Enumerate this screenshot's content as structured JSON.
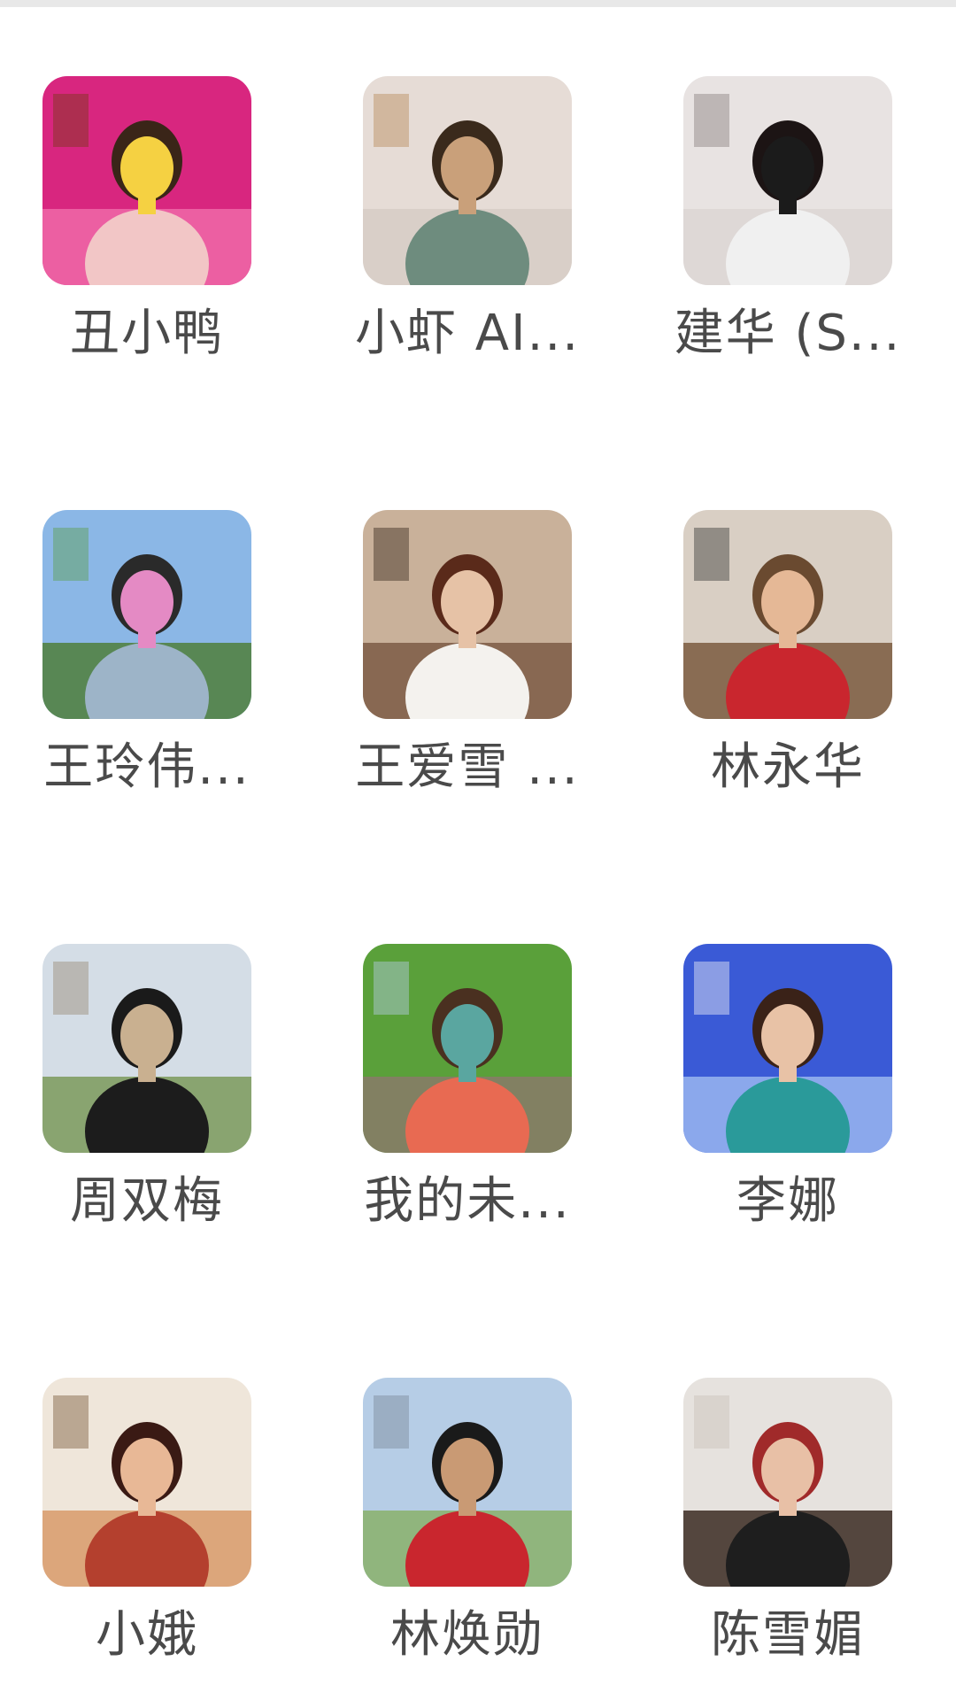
{
  "members": [
    {
      "name": "丑小鸭",
      "avatar": {
        "bg": "#d8267f",
        "bg2": "#f06aa8",
        "person": "#f2c6c6",
        "hair": "#3a2518",
        "accent": "#f5d142",
        "extra": "#7a3a18"
      }
    },
    {
      "name": "小虾 AI...",
      "avatar": {
        "bg": "#e6dcd6",
        "bg2": "#d6ccc6",
        "person": "#6e8c7e",
        "hair": "#3a2a1c",
        "accent": "#c9a07a",
        "extra": "#b78a5a"
      }
    },
    {
      "name": "建华 (S...",
      "avatar": {
        "bg": "#e8e3e2",
        "bg2": "#dcd6d4",
        "person": "#f0f0f0",
        "hair": "#1c1414",
        "accent": "#1b1b1b",
        "extra": "#8a7e7e"
      }
    },
    {
      "name": "王玲伟...",
      "avatar": {
        "bg": "#8bb7e6",
        "bg2": "#4f7f3a",
        "person": "#9db4c8",
        "hair": "#2a2a2a",
        "accent": "#e48ac4",
        "extra": "#5ea050"
      }
    },
    {
      "name": "王爱雪 ...",
      "avatar": {
        "bg": "#c9b19a",
        "bg2": "#7c5c45",
        "person": "#f4f2ee",
        "hair": "#5a2a1a",
        "accent": "#e6c2a6",
        "extra": "#3a2a20"
      }
    },
    {
      "name": "林永华",
      "avatar": {
        "bg": "#d9cfc4",
        "bg2": "#7a5a40",
        "person": "#c9262e",
        "hair": "#6a4a30",
        "accent": "#e5b896",
        "extra": "#3a3a3a"
      }
    },
    {
      "name": "周双梅",
      "avatar": {
        "bg": "#d4dde6",
        "bg2": "#7b9a5a",
        "person": "#1c1c1c",
        "hair": "#1a1a1a",
        "accent": "#c9b090",
        "extra": "#9a8a76"
      }
    },
    {
      "name": "我的未...",
      "avatar": {
        "bg": "#5aa03a",
        "bg2": "#8a7a6a",
        "person": "#e86a52",
        "hair": "#4a3020",
        "accent": "#5aa6a0",
        "extra": "#b6cde6"
      }
    },
    {
      "name": "李娜",
      "avatar": {
        "bg": "#3a5ad6",
        "bg2": "#9ab6f0",
        "person": "#2a9a9a",
        "hair": "#3a2218",
        "accent": "#e8c2a6",
        "extra": "#f0f0f6"
      }
    },
    {
      "name": "小娥",
      "avatar": {
        "bg": "#efe6da",
        "bg2": "#d89a6a",
        "person": "#b4402e",
        "hair": "#3a1a14",
        "accent": "#e8b896",
        "extra": "#7a5a3a"
      }
    },
    {
      "name": "林焕勋",
      "avatar": {
        "bg": "#b6cde6",
        "bg2": "#8ab06a",
        "person": "#c9262e",
        "hair": "#1a1a1a",
        "accent": "#c99a74",
        "extra": "#7a8a9a"
      }
    },
    {
      "name": "陈雪媚",
      "avatar": {
        "bg": "#e6e2de",
        "bg2": "#3a2a22",
        "person": "#1e1e1e",
        "hair": "#a02a2a",
        "accent": "#e8c0a6",
        "extra": "#c9c0b8"
      }
    }
  ]
}
